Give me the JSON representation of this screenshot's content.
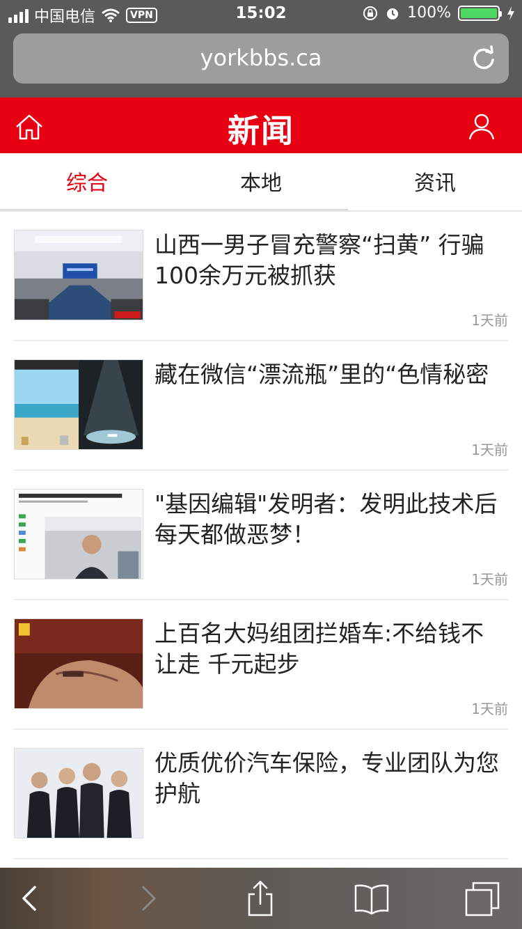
{
  "status": {
    "carrier": "中国电信",
    "vpn": "VPN",
    "time": "15:02",
    "battery": "100%",
    "battery_level": 1.0
  },
  "browser": {
    "url": "yorkbbs.ca"
  },
  "header": {
    "title": "新闻"
  },
  "tabs": [
    {
      "label": "综合",
      "active": true
    },
    {
      "label": "本地",
      "active": false
    },
    {
      "label": "资讯",
      "active": false
    }
  ],
  "articles": [
    {
      "title": "山西一男子冒充警察“扫黄” 行骗100余万元被抓获",
      "time": "1天前"
    },
    {
      "title": "藏在微信“漂流瓶”里的“色情秘密",
      "time": "1天前"
    },
    {
      "title": "\"基因编辑\"发明者：发明此技术后 每天都做恶梦！",
      "time": "1天前"
    },
    {
      "title": "上百名大妈组团拦婚车:不给钱不让走 千元起步",
      "time": "1天前"
    },
    {
      "title": "优质优价汽车保险，专业团队为您护航",
      "time": ""
    }
  ],
  "icons": {
    "home": "home-icon",
    "user": "user-icon",
    "back": "chevron-left-icon",
    "forward": "chevron-right-icon",
    "share": "share-icon",
    "bookmarks": "book-icon",
    "tabs": "tabs-icon"
  },
  "colors": {
    "brand_red": "#e60012",
    "battery_green": "#4cd964"
  }
}
